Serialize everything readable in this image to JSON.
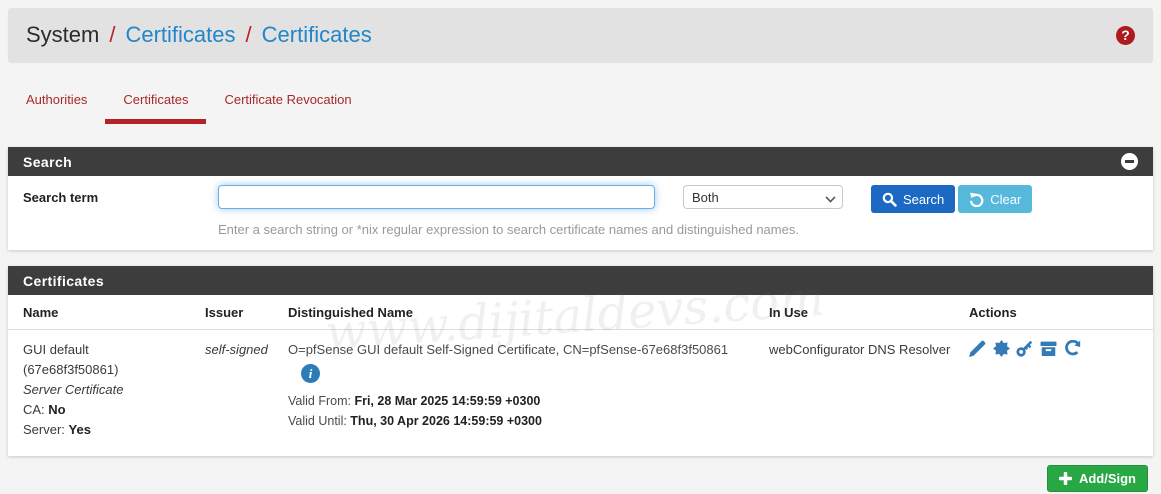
{
  "breadcrumb": {
    "root": "System",
    "sep1": "/",
    "link1": "Certificates",
    "sep2": "/",
    "link2": "Certificates",
    "help_glyph": "?"
  },
  "tabs": [
    {
      "label": "Authorities"
    },
    {
      "label": "Certificates"
    },
    {
      "label": "Certificate Revocation"
    }
  ],
  "search": {
    "panel_title": "Search",
    "term_label": "Search term",
    "term_value": "",
    "scope_value": "Both",
    "search_button": "Search",
    "clear_button": "Clear",
    "hint": "Enter a search string or *nix regular expression to search certificate names and distinguished names."
  },
  "certificates": {
    "panel_title": "Certificates",
    "columns": [
      "Name",
      "Issuer",
      "Distinguished Name",
      "In Use",
      "Actions"
    ],
    "row": {
      "name_line1": "GUI default",
      "name_line2": "(67e68f3f50861)",
      "type": "Server Certificate",
      "ca_label": "CA: ",
      "ca_value": "No",
      "server_label": "Server: ",
      "server_value": "Yes",
      "issuer": "self-signed",
      "dn": "O=pfSense GUI default Self-Signed Certificate, CN=pfSense-67e68f3f50861",
      "info_glyph": "i",
      "valid_from_label": "Valid From: ",
      "valid_from_value": "Fri, 28 Mar 2025 14:59:59 +0300",
      "valid_until_label": "Valid Until: ",
      "valid_until_value": "Thu, 30 Apr 2026 14:59:59 +0300",
      "in_use": "webConfigurator DNS Resolver",
      "action_icons": [
        "edit",
        "export-certificate",
        "export-private-key",
        "export-pkcs12",
        "renew"
      ]
    }
  },
  "footer": {
    "add_sign_button": "Add/Sign"
  },
  "watermark": "www.dijitaldevs.com",
  "colors": {
    "accent_red": "#b42127",
    "link_blue": "#2386c8",
    "panel_header_bg": "#3d3d3d",
    "primary_blue": "#1c69c4",
    "info_blue": "#56b9dc",
    "success_green": "#28a745",
    "icon_blue": "#337ab7"
  }
}
